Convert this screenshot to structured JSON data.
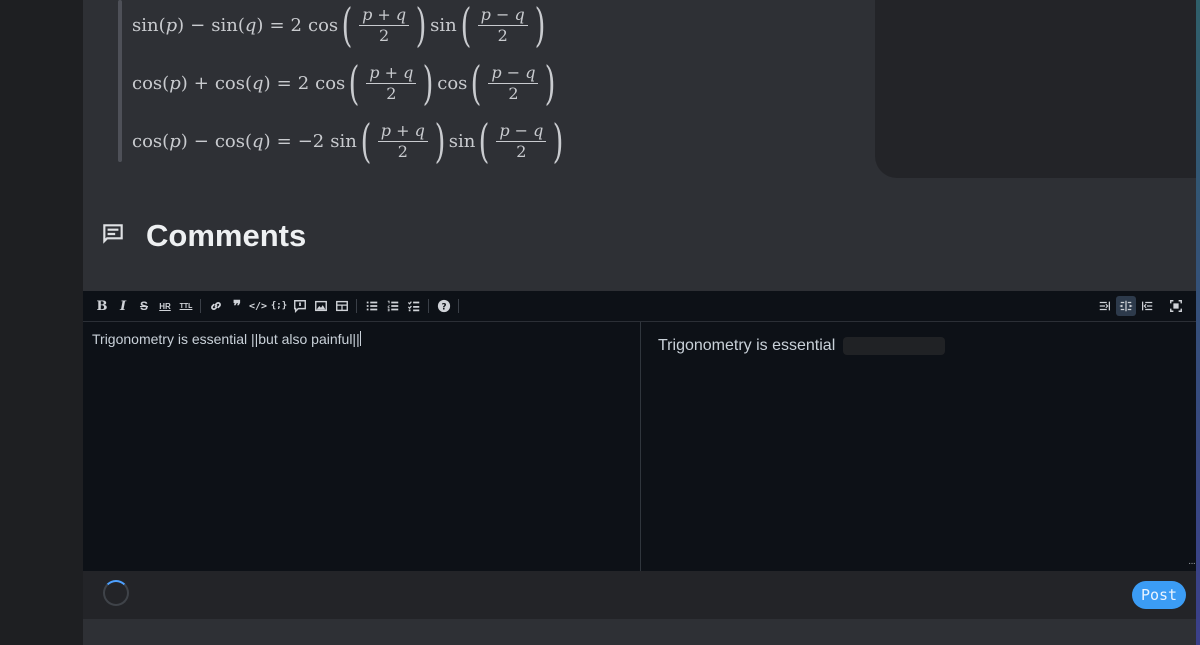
{
  "comments": {
    "heading": "Comments",
    "icon": "comment-icon"
  },
  "editor": {
    "toolbar": {
      "buttons": [
        "bold",
        "italic",
        "strikethrough",
        "horizontal-rule",
        "title",
        "link",
        "quote",
        "code",
        "code-block",
        "comment",
        "image",
        "table",
        "unordered-list",
        "ordered-list",
        "check-list",
        "help"
      ],
      "view_modes": [
        "editor-only",
        "split-view",
        "preview-only",
        "fullscreen"
      ],
      "active_view_mode": "split-view"
    },
    "source_text": "Trigonometry is essential ||but also painful||",
    "preview_text": "Trigonometry is essential",
    "preview_spoiler_hidden": true
  },
  "footer": {
    "post_label": "Post",
    "loading": true
  },
  "colors": {
    "accent": "#3b9cf5",
    "page_bg": "#2e3035",
    "editor_bg": "#0d1117"
  }
}
